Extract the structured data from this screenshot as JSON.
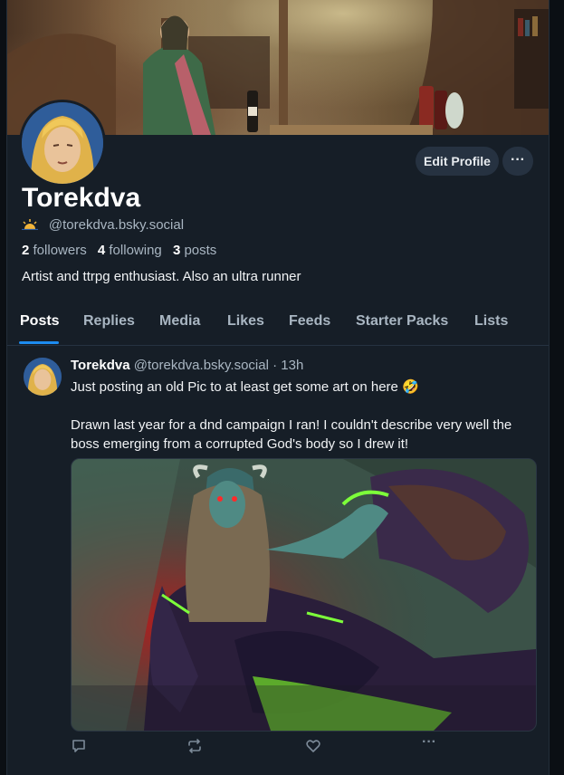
{
  "profile": {
    "display_name": "Torekdva",
    "handle": "@torekdva.bsky.social",
    "followers_count": "2",
    "followers_label": "followers",
    "following_count": "4",
    "following_label": "following",
    "posts_count": "3",
    "posts_label": "posts",
    "bio": "Artist and ttrpg enthusiast. Also an ultra runner"
  },
  "buttons": {
    "edit_profile": "Edit Profile",
    "more": "···"
  },
  "tabs": [
    "Posts",
    "Replies",
    "Media",
    "Likes",
    "Feeds",
    "Starter Packs",
    "Lists"
  ],
  "active_tab": "Posts",
  "post": {
    "author_name": "Torekdva",
    "author_handle": "@torekdva.bsky.social",
    "separator": "·",
    "time": "13h",
    "line1": "Just posting an old Pic to at least get some art on here 🤣",
    "line2": "Drawn last year for a dnd campaign I ran! I couldn't describe very well the boss emerging from a corrupted God's body so I drew it!",
    "more_label": "···"
  },
  "icons": {
    "handle_badge": "sunrise-icon",
    "reply": "reply-icon",
    "repost": "repost-icon",
    "like": "heart-icon",
    "more": "more-icon"
  },
  "colors": {
    "accent": "#1d8cf0",
    "background": "#161e27",
    "muted": "#a9b6c2"
  }
}
